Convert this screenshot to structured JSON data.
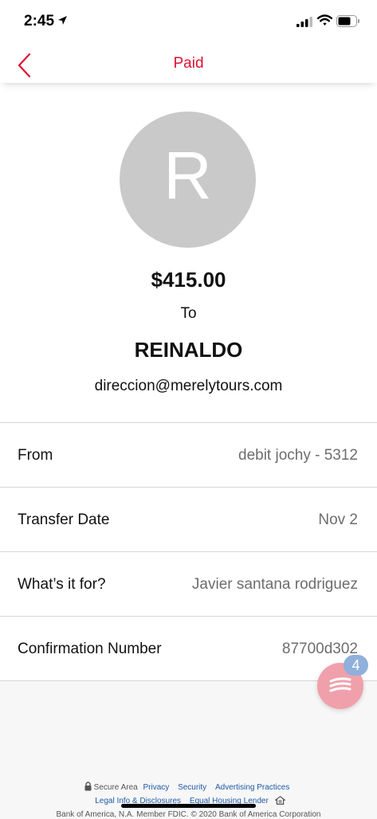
{
  "status_bar": {
    "time": "2:45",
    "icons": [
      "location-arrow-icon",
      "cellular-signal-icon",
      "wifi-icon",
      "battery-icon"
    ]
  },
  "nav": {
    "title": "Paid",
    "back_icon": "chevron-left-icon"
  },
  "colors": {
    "accent_red": "#dc1431",
    "avatar_gray": "#c9c9c9",
    "fab_pink": "#f0a0ab",
    "badge_blue": "#8fb0da",
    "link_blue": "#1f5aa6"
  },
  "summary": {
    "avatar_initial": "R",
    "amount": "$415.00",
    "to_label": "To",
    "recipient_name": "REINALDO",
    "recipient_email": "direccion@merelytours.com"
  },
  "details": [
    {
      "label": "From",
      "value": "debit jochy - 5312"
    },
    {
      "label": "Transfer Date",
      "value": "Nov 2"
    },
    {
      "label": "What’s it for?",
      "value": "Javier santana rodriguez"
    },
    {
      "label": "Confirmation Number",
      "value": "87700d302"
    }
  ],
  "chat": {
    "icon": "chat-icon",
    "badge_count": "4"
  },
  "footer": {
    "secure_area": "Secure Area",
    "links_row1": [
      "Privacy",
      "Security",
      "Advertising Practices"
    ],
    "links_row2": [
      "Legal Info & Disclosures",
      "Equal Housing Lender"
    ],
    "copyright": "Bank of America, N.A. Member FDIC. © 2020 Bank of America Corporation"
  }
}
